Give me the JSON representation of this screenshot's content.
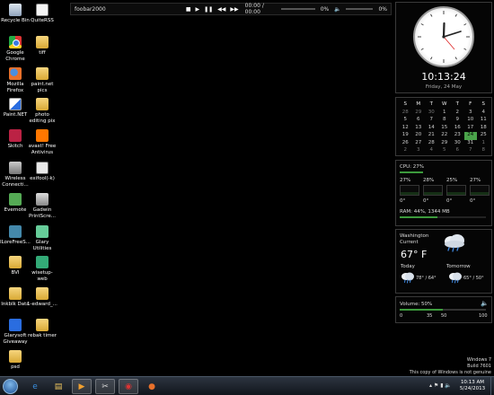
{
  "desktop_icons": [
    {
      "label": "Recycle Bin",
      "icon": "recycle-bin-icon"
    },
    {
      "label": "QuiteRSS",
      "icon": "quiterss-icon"
    },
    {
      "label": "Google Chrome",
      "icon": "chrome-icon"
    },
    {
      "label": "tiff",
      "icon": "folder-icon"
    },
    {
      "label": "Mozilla Firefox",
      "icon": "firefox-icon"
    },
    {
      "label": "paint.net pics",
      "icon": "folder-icon"
    },
    {
      "label": "Paint.NET",
      "icon": "paint-net-icon"
    },
    {
      "label": "photo editing pix",
      "icon": "folder-icon"
    },
    {
      "label": "Skitch",
      "icon": "skitch-icon"
    },
    {
      "label": "avast! Free Antivirus",
      "icon": "avast-icon"
    },
    {
      "label": "Wireless Connecti...",
      "icon": "wireless-icon"
    },
    {
      "label": "exifool(-k)",
      "icon": "exiftool-icon"
    },
    {
      "label": "Evernote",
      "icon": "evernote-icon"
    },
    {
      "label": "Gadwin PrintScre...",
      "icon": "gadwin-icon"
    },
    {
      "label": "ILoreFreeS...",
      "icon": "app-icon"
    },
    {
      "label": "Glary Utilities",
      "icon": "glary-icon"
    },
    {
      "label": "BVI",
      "icon": "folder-icon"
    },
    {
      "label": "wisetup-web",
      "icon": "wisetup-icon"
    },
    {
      "label": "Inkblk Data",
      "icon": "folder-icon"
    },
    {
      "label": "1-edward_...",
      "icon": "folder-icon"
    },
    {
      "label": "Glarysoft Giveaway",
      "icon": "glarysoft-icon"
    },
    {
      "label": "rebak timer",
      "icon": "folder-icon"
    },
    {
      "label": "psd",
      "icon": "folder-icon"
    }
  ],
  "player": {
    "title": "foobar2000",
    "time": "00:00 / 00:00",
    "progress_pct": "0%",
    "volume_pct": "0%"
  },
  "clock": {
    "time": "10:13:24",
    "date": "Friday, 24 May"
  },
  "calendar": {
    "headers": [
      "S",
      "M",
      "T",
      "W",
      "T",
      "F",
      "S"
    ],
    "weeks": [
      [
        "28",
        "29",
        "30",
        "1",
        "2",
        "3",
        "4"
      ],
      [
        "5",
        "6",
        "7",
        "8",
        "9",
        "10",
        "11"
      ],
      [
        "12",
        "13",
        "14",
        "15",
        "16",
        "17",
        "18"
      ],
      [
        "19",
        "20",
        "21",
        "22",
        "23",
        "24",
        "25"
      ],
      [
        "26",
        "27",
        "28",
        "29",
        "30",
        "31",
        "1"
      ],
      [
        "2",
        "3",
        "4",
        "5",
        "6",
        "7",
        "8"
      ]
    ],
    "today": "24"
  },
  "cpu": {
    "title": "CPU: 27%",
    "usage_fraction": 0.27,
    "cores": [
      {
        "pct": "27%",
        "temp": "0°"
      },
      {
        "pct": "28%",
        "temp": "0°"
      },
      {
        "pct": "25%",
        "temp": "0°"
      },
      {
        "pct": "27%",
        "temp": "0°"
      }
    ],
    "ram": "RAM: 44%, 1344 MB",
    "ram_fraction": 0.44
  },
  "weather": {
    "city": "Washington",
    "current_label": "Current",
    "temp": "67° F",
    "today_label": "Today",
    "today_hl": "78° / 64°",
    "tomorrow_label": "Tomorrow",
    "tomorrow_hl": "65° / 50°"
  },
  "volume": {
    "title": "Volume: 50%",
    "level_fraction": 0.5,
    "ticks": [
      "0",
      "35",
      "50",
      "100"
    ]
  },
  "watermark": {
    "line1": "Windows 7",
    "line2": "Build 7601",
    "line3": "This copy of Windows is not genuine"
  },
  "taskbar": {
    "time": "10:13 AM",
    "date": "5/24/2013"
  },
  "colors": {
    "accent_green": "#3c9a3c",
    "desktop_bg": "#000000"
  }
}
